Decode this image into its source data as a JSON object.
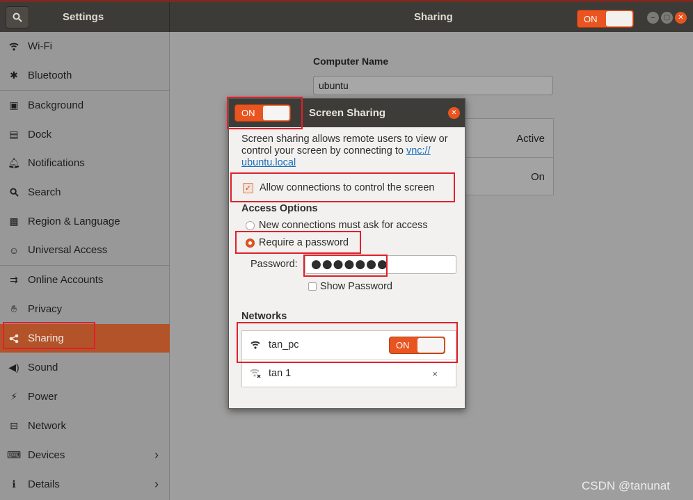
{
  "header": {
    "settings_title": "Settings",
    "panel_title": "Sharing",
    "master_switch_label": "ON",
    "window_buttons": [
      "minimize-icon",
      "maximize-icon",
      "close-icon"
    ]
  },
  "sidebar": {
    "items": [
      {
        "label": "Wi-Fi",
        "icon": "wifi-icon"
      },
      {
        "label": "Bluetooth",
        "icon": "bluetooth-icon"
      },
      {
        "label": "Background",
        "icon": "background-icon"
      },
      {
        "label": "Dock",
        "icon": "dock-icon"
      },
      {
        "label": "Notifications",
        "icon": "bell-icon"
      },
      {
        "label": "Search",
        "icon": "search-icon"
      },
      {
        "label": "Region & Language",
        "icon": "camera-icon"
      },
      {
        "label": "Universal Access",
        "icon": "accessibility-icon"
      },
      {
        "label": "Online Accounts",
        "icon": "online-accounts-icon"
      },
      {
        "label": "Privacy",
        "icon": "hand-icon"
      },
      {
        "label": "Sharing",
        "icon": "share-icon",
        "selected": true
      },
      {
        "label": "Sound",
        "icon": "speaker-icon"
      },
      {
        "label": "Power",
        "icon": "power-icon"
      },
      {
        "label": "Network",
        "icon": "network-icon"
      },
      {
        "label": "Devices",
        "icon": "devices-icon",
        "chevron": true
      },
      {
        "label": "Details",
        "icon": "info-icon",
        "chevron": true
      }
    ]
  },
  "main": {
    "computer_name_label": "Computer Name",
    "computer_name_value": "ubuntu",
    "status_1": "Active",
    "status_2": "On"
  },
  "dialog": {
    "switch_label": "ON",
    "title": "Screen Sharing",
    "description_prefix": "Screen sharing allows remote users to view or control your screen by connecting to ",
    "vnc_link": "vnc:// ubuntu.local",
    "allow_control_label": "Allow connections to control the screen",
    "allow_control_checked": true,
    "access_options_label": "Access Options",
    "option_ask": "New connections must ask for access",
    "option_password": "Require a password",
    "password_label": "Password:",
    "password_value": "●●●●●●●",
    "show_password_label": "Show Password",
    "networks_label": "Networks",
    "networks": [
      {
        "name": "tan_pc",
        "switch_label": "ON",
        "icon": "wifi-icon"
      },
      {
        "name": "tan 1",
        "icon": "wifi-disconnected-icon",
        "delete": "×"
      }
    ]
  },
  "watermark": "CSDN @tanunat",
  "colors": {
    "accent": "#e95420",
    "header": "#3d3b37",
    "selected_sidebar": "#b2532a",
    "annotation": "#e0202a"
  }
}
